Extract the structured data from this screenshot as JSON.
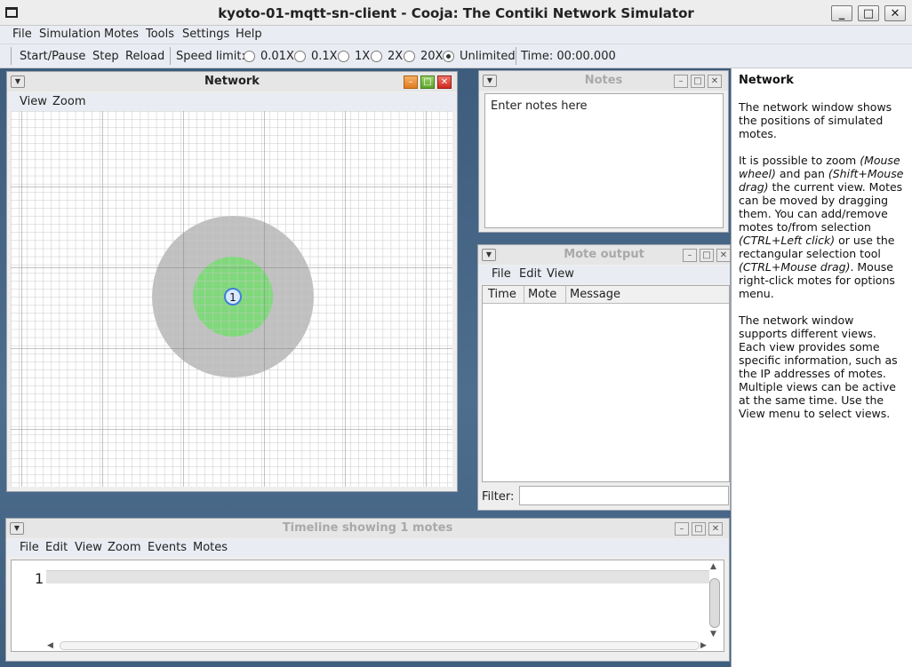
{
  "window": {
    "title": "kyoto-01-mqtt-sn-client - Cooja: The Contiki Network Simulator",
    "controls": {
      "minimize": "_",
      "maximize": "□",
      "close": "✕"
    }
  },
  "menubar": {
    "items": [
      "File",
      "Simulation",
      "Motes",
      "Tools",
      "Settings",
      "Help"
    ]
  },
  "toolbar": {
    "start_pause": "Start/Pause",
    "step": "Step",
    "reload": "Reload",
    "speed_limit_label": "Speed limit:",
    "speeds": [
      "0.01X",
      "0.1X",
      "1X",
      "2X",
      "20X",
      "Unlimited"
    ],
    "selected_speed": "Unlimited",
    "time": "Time: 00:00.000"
  },
  "network": {
    "title": "Network",
    "menu": [
      "View",
      "Zoom"
    ],
    "mote_id": "1",
    "colors": {
      "tx_range": "#c0c0c0",
      "interference": "#7fd97a",
      "mote": "#3f7fd6"
    }
  },
  "notes": {
    "title": "Notes",
    "text": "Enter notes here"
  },
  "mote_output": {
    "title": "Mote output",
    "menu": [
      "File",
      "Edit",
      "View"
    ],
    "columns": [
      "Time",
      "Mote",
      "Message"
    ],
    "filter_label": "Filter:"
  },
  "timeline": {
    "title": "Timeline showing 1 motes",
    "menu": [
      "File",
      "Edit",
      "View",
      "Zoom",
      "Events",
      "Motes"
    ],
    "rows": [
      "1"
    ]
  },
  "help": {
    "title": "Network",
    "p1": "The network window shows the positions of simulated motes.",
    "p2_a": "It is possible to zoom ",
    "p2_b": "(Mouse wheel)",
    "p2_c": " and pan ",
    "p2_d": "(Shift+Mouse drag)",
    "p2_e": " the current view. Motes can be moved by dragging them. You can add/remove motes to/from selection ",
    "p2_f": "(CTRL+Left click)",
    "p2_g": " or use the rectangular selection tool ",
    "p2_h": "(CTRL+Mouse drag)",
    "p2_i": ". Mouse right-click motes for options menu.",
    "p3": "The network window supports different views. Each view provides some specific information, such as the IP addresses of motes. Multiple views can be active at the same time. Use the View menu to select views."
  }
}
